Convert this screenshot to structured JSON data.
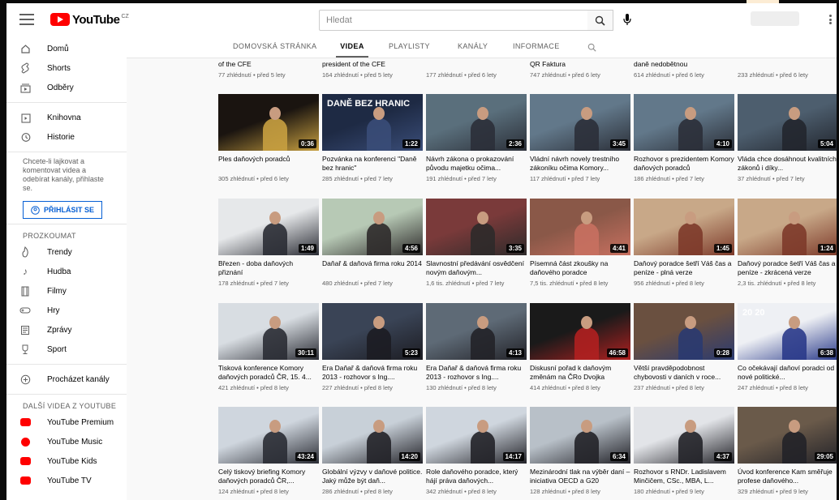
{
  "header": {
    "logo_text": "YouTube",
    "logo_country": "CZ",
    "search_placeholder": "Hledat",
    "icons": [
      "menu-icon",
      "search-icon",
      "microphone-icon",
      "more-vert-icon"
    ]
  },
  "sidebar": {
    "main_items": [
      {
        "label": "Domů",
        "icon": "home-icon"
      },
      {
        "label": "Shorts",
        "icon": "shorts-icon"
      },
      {
        "label": "Odběry",
        "icon": "subscriptions-icon"
      }
    ],
    "library_items": [
      {
        "label": "Knihovna",
        "icon": "library-icon"
      },
      {
        "label": "Historie",
        "icon": "history-icon"
      }
    ],
    "signin_note": "Chcete-li lajkovat a komentovat videa a odebírat kanály, přihlaste se.",
    "signin_button": "PŘIHLÁSIT SE",
    "explore_heading": "PROZKOUMAT",
    "explore_items": [
      {
        "label": "Trendy",
        "icon": "trending-icon"
      },
      {
        "label": "Hudba",
        "icon": "music-icon"
      },
      {
        "label": "Filmy",
        "icon": "film-icon"
      },
      {
        "label": "Hry",
        "icon": "gaming-icon"
      },
      {
        "label": "Zprávy",
        "icon": "news-icon"
      },
      {
        "label": "Sport",
        "icon": "sport-icon"
      }
    ],
    "browse_channels": "Procházet kanály",
    "more_heading": "DALŠÍ VIDEA Z YOUTUBE",
    "more_items": [
      {
        "label": "YouTube Premium",
        "color": "#ff0000"
      },
      {
        "label": "YouTube Music",
        "color": "#ff0000"
      },
      {
        "label": "YouTube Kids",
        "color": "#ff0000"
      },
      {
        "label": "YouTube TV",
        "color": "#ff0000"
      }
    ]
  },
  "tabs": [
    {
      "label": "DOMOVSKÁ STRÁNKA",
      "active": false
    },
    {
      "label": "VIDEA",
      "active": true
    },
    {
      "label": "PLAYLISTY",
      "active": false
    },
    {
      "label": "KANÁLY",
      "active": false
    },
    {
      "label": "INFORMACE",
      "active": false
    }
  ],
  "row0": [
    {
      "title": "of the CFE",
      "meta": "77 zhlédnutí • před 5 lety"
    },
    {
      "title": "president of the CFE",
      "meta": "164 zhlédnutí • před 5 lety"
    },
    {
      "title": "",
      "meta": "177 zhlédnutí • před 6 lety"
    },
    {
      "title": "QR Faktura",
      "meta": "747 zhlédnutí • před 6 lety"
    },
    {
      "title": "daně nedobětnou",
      "meta": "614 zhlédnutí • před 6 lety"
    },
    {
      "title": "",
      "meta": "233 zhlédnutí • před 6 lety"
    }
  ],
  "rows": [
    [
      {
        "title": "Ples daňových poradců",
        "meta": "305 zhlédnutí • před 6 lety",
        "duration": "0:36",
        "bg": "#1a1410",
        "accent": "#c8a040",
        "thumb_text": ""
      },
      {
        "title": "Pozvánka na konferenci \"Daně bez hranic\"",
        "meta": "285 zhlédnutí • před 7 lety",
        "duration": "1:22",
        "bg": "#1e2a44",
        "accent": "#3a4d78",
        "thumb_text": "DANĚ BEZ HRANIC"
      },
      {
        "title": "Návrh zákona o prokazování původu majetku očima...",
        "meta": "191 zhlédnutí • před 7 lety",
        "duration": "2:36",
        "bg": "#5a6f7c",
        "accent": "#2b2f38",
        "thumb_text": ""
      },
      {
        "title": "Vládní návrh novely trestního zákoníku očima Komory...",
        "meta": "117 zhlédnutí • před 7 lety",
        "duration": "3:45",
        "bg": "#62788a",
        "accent": "#2b2f38",
        "thumb_text": ""
      },
      {
        "title": "Rozhovor s prezidentem Komory daňových poradců",
        "meta": "186 zhlédnutí • před 7 lety",
        "duration": "4:10",
        "bg": "#62788a",
        "accent": "#2b2f38",
        "thumb_text": ""
      },
      {
        "title": "Vláda chce dosáhnout kvalitních zákonů i díky...",
        "meta": "37 zhlédnutí • před 7 lety",
        "duration": "5:04",
        "bg": "#4d5e6e",
        "accent": "#22262e",
        "thumb_text": ""
      }
    ],
    [
      {
        "title": "Březen - doba daňových přiznání",
        "meta": "178 zhlédnutí • před 7 lety",
        "duration": "1:49",
        "bg": "#e6e8ea",
        "accent": "#2a2c34",
        "thumb_text": ""
      },
      {
        "title": "Daňař & daňová firma roku 2014",
        "meta": "480 zhlédnutí • před 7 lety",
        "duration": "4:56",
        "bg": "#b7c9b5",
        "accent": "#2d2a2a",
        "thumb_text": ""
      },
      {
        "title": "Slavnostní předávání osvědčení novým daňovým...",
        "meta": "1,6 tis. zhlédnutí • před 7 lety",
        "duration": "3:35",
        "bg": "#7a3a3a",
        "accent": "#2d2a2a",
        "thumb_text": ""
      },
      {
        "title": "Písemná část zkoušky na daňového poradce",
        "meta": "7,5 tis. zhlédnutí • před 8 lety",
        "duration": "4:41",
        "bg": "#8a5848",
        "accent": "#c87060",
        "thumb_text": ""
      },
      {
        "title": "Daňový poradce šetří Váš čas a peníze - plná verze",
        "meta": "956 zhlédnutí • před 8 lety",
        "duration": "1:45",
        "bg": "#c8a888",
        "accent": "#7d3a2a",
        "thumb_text": ""
      },
      {
        "title": "Daňový poradce šetří Váš čas a peníze - zkrácená verze",
        "meta": "2,3 tis. zhlédnutí • před 8 lety",
        "duration": "1:24",
        "bg": "#c8a888",
        "accent": "#7d3a2a",
        "thumb_text": ""
      }
    ],
    [
      {
        "title": "Tisková konference Komory daňových poradců ČR, 15. 4...",
        "meta": "421 zhlédnutí • před 8 lety",
        "duration": "30:11",
        "bg": "#d8dde2",
        "accent": "#2a2c34",
        "thumb_text": ""
      },
      {
        "title": "Era Daňař & daňová firma roku 2013 - rozhovor s Ing....",
        "meta": "227 zhlédnutí • před 8 lety",
        "duration": "5:23",
        "bg": "#3a4456",
        "accent": "#1c1c22",
        "thumb_text": ""
      },
      {
        "title": "Era Daňař & daňová firma roku 2013 - rozhovor s Ing....",
        "meta": "130 zhlédnutí • před 8 lety",
        "duration": "4:13",
        "bg": "#5e6a76",
        "accent": "#222228",
        "thumb_text": ""
      },
      {
        "title": "Diskusní pořad k daňovým změnám na ČRo Dvojka",
        "meta": "414 zhlédnutí • před 8 lety",
        "duration": "46:58",
        "bg": "#1a1a1a",
        "accent": "#b02020",
        "thumb_text": ""
      },
      {
        "title": "Větší pravděpodobnost chybovosti v daních v roce...",
        "meta": "237 zhlédnutí • před 8 lety",
        "duration": "0:28",
        "bg": "#6a5040",
        "accent": "#2a3a70",
        "thumb_text": ""
      },
      {
        "title": "Co očekávají daňoví poradci od nové politické...",
        "meta": "247 zhlédnutí • před 8 lety",
        "duration": "6:38",
        "bg": "#eef0f4",
        "accent": "#2a3a8a",
        "thumb_text": "20  20"
      }
    ],
    [
      {
        "title": "Celý tiskový briefing Komory daňových poradců ČR,...",
        "meta": "124 zhlédnutí • před 8 lety",
        "duration": "43:24",
        "bg": "#cfd6de",
        "accent": "#2a2c34",
        "thumb_text": ""
      },
      {
        "title": "Globální výzvy v daňové politice. Jaký může být daň...",
        "meta": "286 zhlédnutí • před 8 lety",
        "duration": "14:20",
        "bg": "#c8d0d8",
        "accent": "#222228",
        "thumb_text": ""
      },
      {
        "title": "Role daňového poradce, který hájí práva daňových...",
        "meta": "342 zhlédnutí • před 8 lety",
        "duration": "14:17",
        "bg": "#cfd6de",
        "accent": "#222228",
        "thumb_text": ""
      },
      {
        "title": "Mezinárodní tlak na výběr daní – iniciativa OECD a G20",
        "meta": "128 zhlédnutí • před 8 lety",
        "duration": "6:34",
        "bg": "#b8c0c8",
        "accent": "#222228",
        "thumb_text": ""
      },
      {
        "title": "Rozhovor s RNDr. Ladislavem Minčičem, CSc., MBA, L...",
        "meta": "180 zhlédnutí • před 9 lety",
        "duration": "4:37",
        "bg": "#e2e4e8",
        "accent": "#222228",
        "thumb_text": ""
      },
      {
        "title": "Úvod konference Kam směřuje profese daňového...",
        "meta": "329 zhlédnutí • před 9 lety",
        "duration": "29:05",
        "bg": "#6a5a4a",
        "accent": "#222228",
        "thumb_text": ""
      }
    ]
  ]
}
